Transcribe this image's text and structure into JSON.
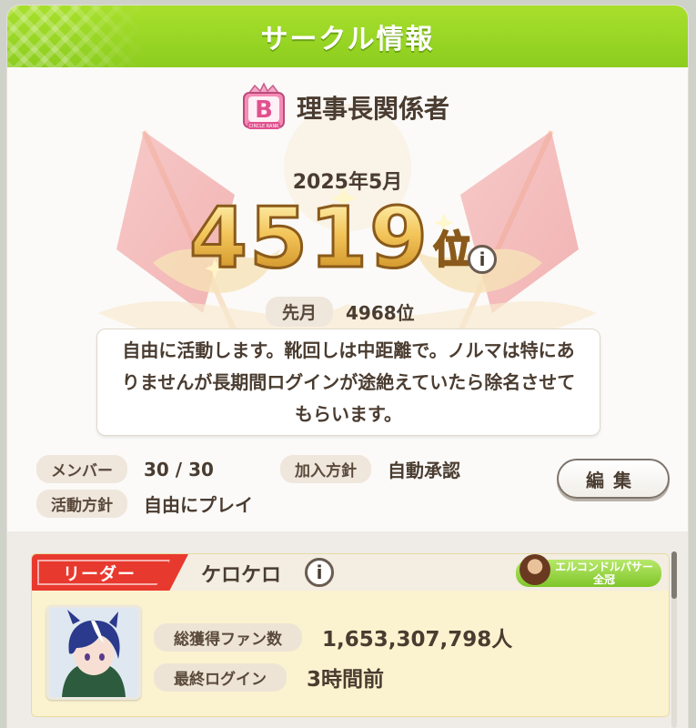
{
  "header": {
    "title": "サークル情報"
  },
  "circle": {
    "rank_badge_letter": "B",
    "rank_badge_caption": "CIRCLE RANK",
    "name": "理事長関係者",
    "month": "2025年5月",
    "rank_number": "4519",
    "rank_unit": "位",
    "info_symbol": "i",
    "prev_label": "先月",
    "prev_value": "4968位",
    "description": "自由に活動します。靴回しは中距離で。ノルマは特にありませんが長期間ログインが途絶えていたら除名させてもらいます。"
  },
  "meta": {
    "members_label": "メンバー",
    "members_value": "30 / 30",
    "join_label": "加入方針",
    "join_value": "自動承認",
    "activity_label": "活動方針",
    "activity_value": "自由にプレイ",
    "edit_button": "編集"
  },
  "leader": {
    "tag": "リーダー",
    "name": "ケロケロ",
    "info_symbol": "i",
    "title_line1": "エルコンドルパサー",
    "title_line2": "全冠",
    "fans_label": "総獲得ファン数",
    "fans_value": "1,653,307,798人",
    "login_label": "最終ログイン",
    "login_value": "3時間前"
  },
  "colors": {
    "header_green": "#8ccd1f",
    "leader_red": "#e8392e",
    "rank_gold": "#f3c55a",
    "card_yellow": "#fbf3cf"
  }
}
